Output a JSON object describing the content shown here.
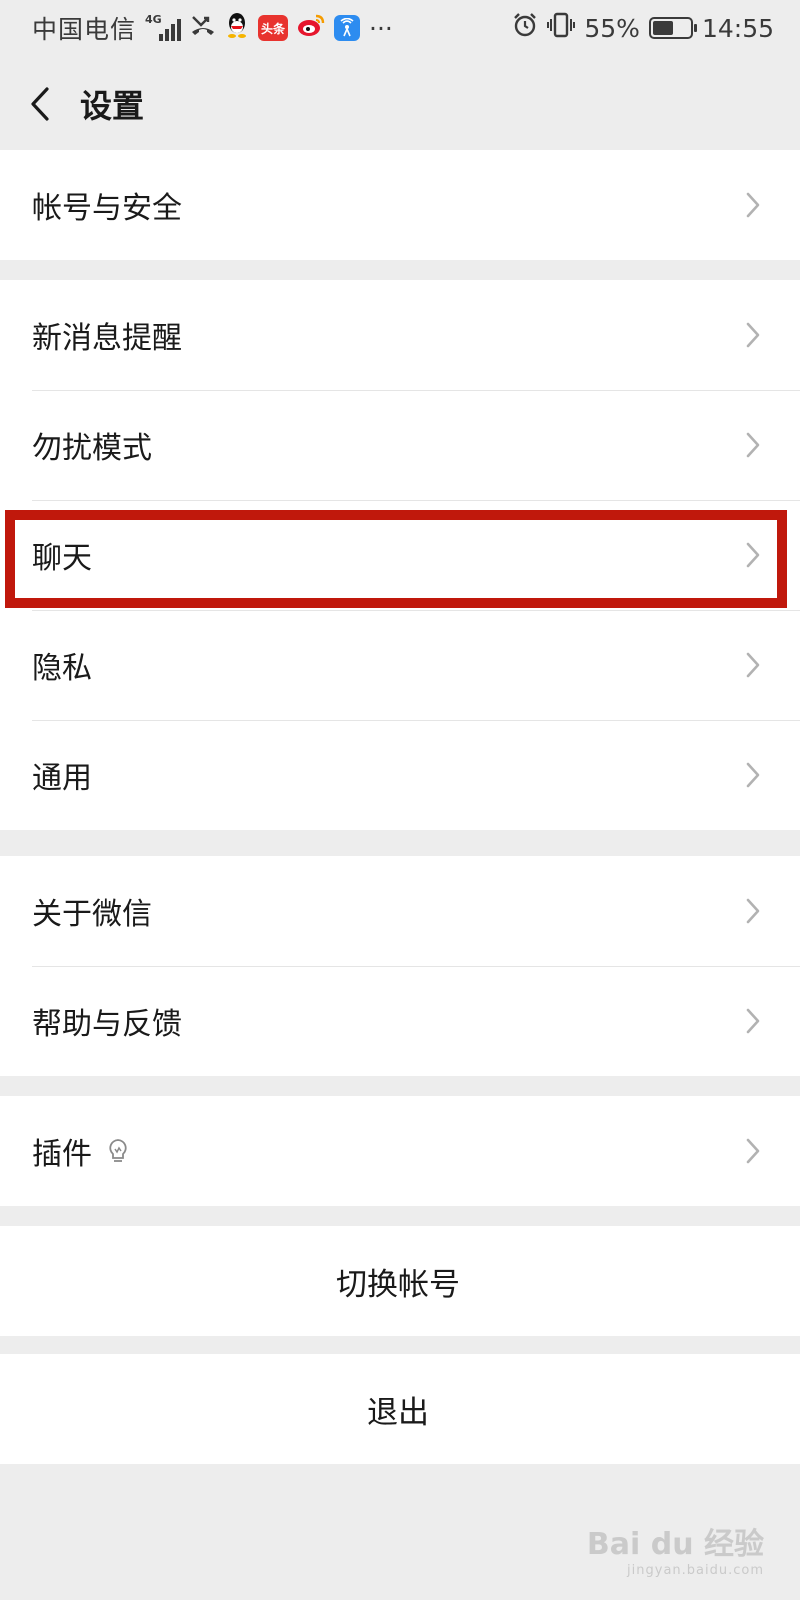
{
  "status_bar": {
    "carrier": "中国电信",
    "network": "4G",
    "app_icons": [
      "missed-call-icon",
      "qq-icon",
      "toutiao-icon",
      "weibo-icon",
      "wifi-share-icon"
    ],
    "toutiao_label": "头条",
    "more": "···",
    "battery": "55%",
    "battery_level": 0.55,
    "time": "14:55"
  },
  "nav": {
    "title": "设置"
  },
  "groups": {
    "account": {
      "item": "帐号与安全"
    },
    "main": {
      "notifications": "新消息提醒",
      "dnd": "勿扰模式",
      "chat": "聊天",
      "privacy": "隐私",
      "general": "通用"
    },
    "about": {
      "about": "关于微信",
      "help": "帮助与反馈"
    },
    "plugins": {
      "item": "插件"
    },
    "switch_account": "切换帐号",
    "logout": "退出"
  },
  "watermark": {
    "brand": "Bai du 经验",
    "url": "jingyan.baidu.com"
  },
  "colors": {
    "background": "#ededed",
    "highlight": "#c0180c",
    "row_bg": "#ffffff"
  }
}
